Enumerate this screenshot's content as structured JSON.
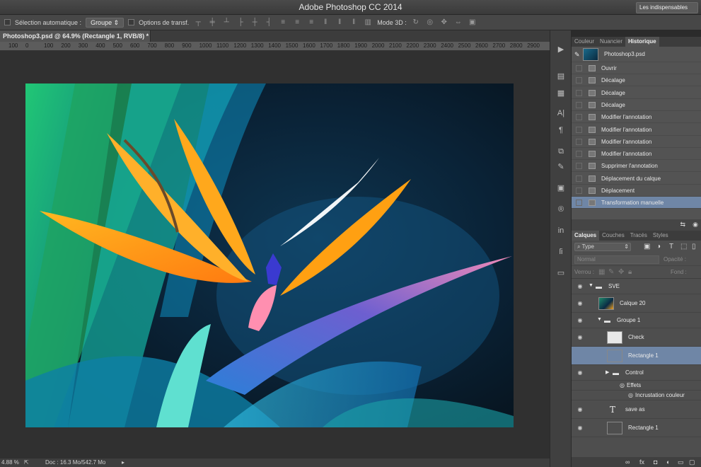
{
  "app": {
    "title": "Adobe Photoshop CC 2014"
  },
  "options": {
    "auto_select_label": "Sélection automatique :",
    "auto_select_value": "Groupe",
    "transform_label": "Options de transf.",
    "mode3d_label": "Mode 3D :",
    "workspace": "Les indispensables"
  },
  "document": {
    "tab_title": "Photoshop3.psd @ 64.9% (Rectangle 1, RVB/8) *",
    "ruler_labels": [
      "100",
      "0",
      "100",
      "200",
      "300",
      "400",
      "500",
      "600",
      "700",
      "800",
      "900",
      "1000",
      "1100",
      "1200",
      "1300",
      "1400",
      "1500",
      "1600",
      "1700",
      "1800",
      "1900",
      "2000",
      "2100",
      "2200",
      "2300",
      "2400",
      "2500",
      "2600",
      "2700",
      "2800",
      "2900"
    ],
    "zoom": "4.88 %",
    "doc_info": "Doc : 16.3 Mo/542.7 Mo"
  },
  "history_panel": {
    "tabs": [
      "Couleur",
      "Nuancier",
      "Historique"
    ],
    "active_tab": "Historique",
    "snapshot": "Photoshop3.psd",
    "steps": [
      "Ouvrir",
      "Décalage",
      "Décalage",
      "Décalage",
      "Modifier l'annotation",
      "Modifier l'annotation",
      "Modifier l'annotation",
      "Modifier l'annotation",
      "Supprimer l'annotation",
      "Déplacement du calque",
      "Déplacement",
      "Transformation manuelle"
    ],
    "selected_index": 11
  },
  "layers_panel": {
    "tabs": [
      "Calques",
      "Couches",
      "Tracés",
      "Styles"
    ],
    "active_tab": "Calques",
    "filter": "Type",
    "blend_mode": "Normal",
    "opacity_label": "Opacité :",
    "lock_label": "Verrou :",
    "fill_label": "Fond :",
    "layers": [
      {
        "name": "SVE",
        "kind": "group",
        "indent": 0
      },
      {
        "name": "Calque 20",
        "kind": "image",
        "indent": 1
      },
      {
        "name": "Groupe 1",
        "kind": "group",
        "indent": 1
      },
      {
        "name": "Check",
        "kind": "smart",
        "indent": 2
      },
      {
        "name": "Rectangle 1",
        "kind": "shape",
        "indent": 2,
        "selected": true
      },
      {
        "name": "Control",
        "kind": "group",
        "indent": 2
      },
      {
        "name": "Effets",
        "kind": "effects",
        "indent": 3
      },
      {
        "name": "Incrustation couleur",
        "kind": "effect",
        "indent": 4
      },
      {
        "name": "save as",
        "kind": "text",
        "indent": 2
      },
      {
        "name": "Rectangle 1",
        "kind": "shape",
        "indent": 2
      }
    ]
  },
  "colors": {
    "bg": "#2b2b2b",
    "panel": "#535353",
    "selected": "#6f86a6"
  }
}
